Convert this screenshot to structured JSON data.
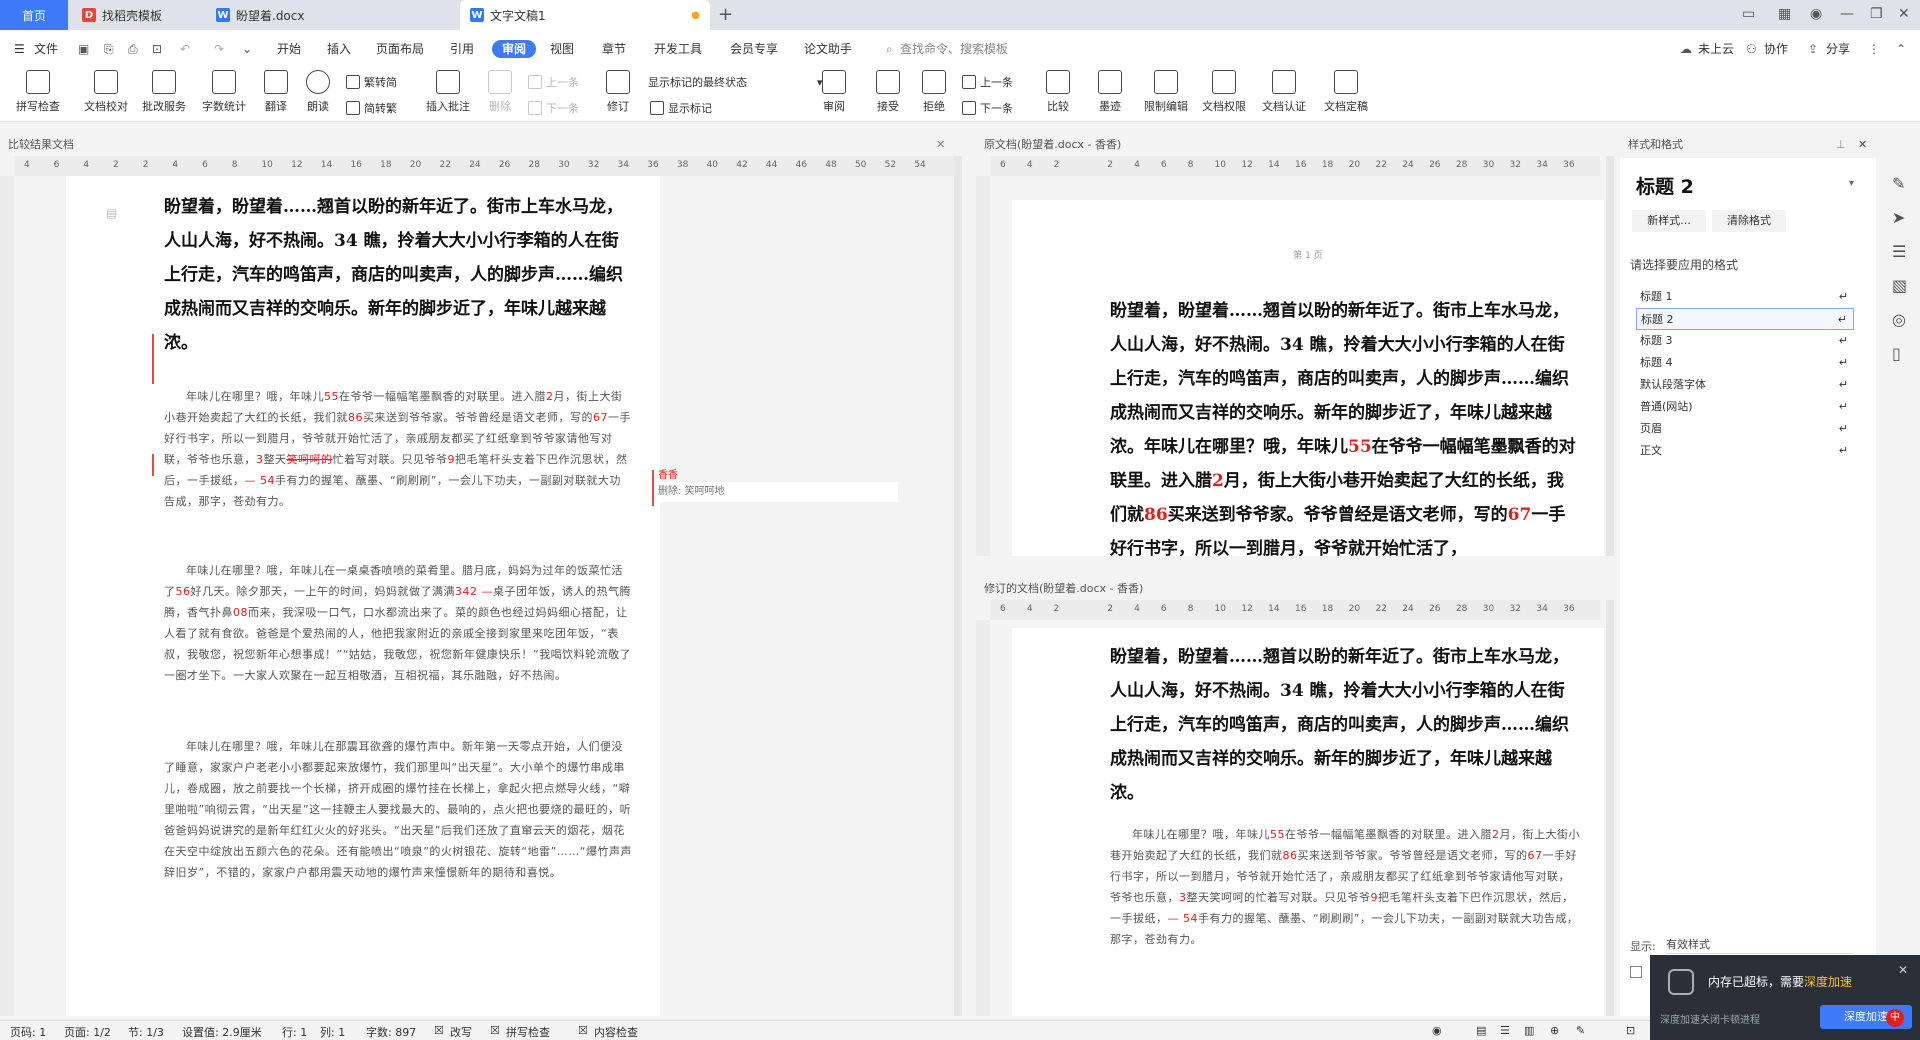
{
  "tabs": {
    "home": "首页",
    "items": [
      {
        "label": "找稻壳模板",
        "icon_color": "#e8453c"
      },
      {
        "label": "盼望着.docx",
        "icon_color": "#2f7bf6"
      },
      {
        "label": "文字文稿1",
        "icon_color": "#2f7bf6"
      }
    ],
    "new_tab": "+"
  },
  "menu": {
    "file": "文件",
    "items": [
      "开始",
      "插入",
      "页面布局",
      "引用",
      "审阅",
      "视图",
      "章节",
      "开发工具",
      "会员专享",
      "论文助手"
    ],
    "active": "审阅",
    "search_placeholder": "查找命令、搜索模板",
    "cloud": "未上云",
    "collab": "协作",
    "share": "分享"
  },
  "ribbon": {
    "buttons": [
      "拼写检查",
      "文档校对",
      "批改服务",
      "字数统计",
      "翻译",
      "朗读"
    ],
    "convert": [
      "繁转简",
      "简转繁"
    ],
    "insert_comment": "插入批注",
    "delete": "删除",
    "prev": "上一条",
    "next": "下一条",
    "revise": "修订",
    "show_final": "显示标记的最终状态",
    "show_markup": "显示标记",
    "review": "审阅",
    "accept": "接受",
    "reject": "拒绝",
    "prev2": "上一条",
    "next2": "下一条",
    "compare": "比较",
    "ink": "墨迹",
    "restrict": "限制编辑",
    "rights": "文档权限",
    "cert": "文档认证",
    "final": "文档定稿"
  },
  "left_pane": {
    "title": "比较结果文档",
    "ruler": [
      "4",
      "6",
      "4",
      "2",
      "2",
      "4",
      "6",
      "8",
      "10",
      "12",
      "14",
      "16",
      "18",
      "20",
      "22",
      "24",
      "26",
      "28",
      "30",
      "32",
      "34",
      "36",
      "38",
      "40",
      "42",
      "44",
      "46",
      "48",
      "50",
      "52",
      "54"
    ],
    "heading": "盼望着，盼望着……翘首以盼的新年近了。街市上车水马龙，人山人海，好不热闹。34 瞧，拎着大大小小行李箱的人在街上行走，汽车的鸣笛声，商店的叫卖声，人的脚步声……编织成热闹而又吉祥的交响乐。新年的脚步近了，年味儿越来越浓。",
    "para1_a": "年味儿在哪里？哦，年味儿",
    "n55": "55",
    "para1_b": "在爷爷一幅幅笔墨飘香的对联里。进入腊",
    "n2": "2",
    "para1_c": "月，街上大街小巷开始卖起了大红的长纸，我们就",
    "n86": "86",
    "para1_d": "买来送到爷爷家。爷爷曾经是语文老师，写的",
    "n67": "67",
    "para1_e": "一手好行书字，所以一到腊月，爷爷就开始忙活了，亲戚朋友都买了红纸拿到爷爷家请他写对联，爷爷也乐意，",
    "n3": "3",
    "para1_f": "整天",
    "del_text": "笑呵呵的",
    "para1_g": "忙着写对联。只见爷爷",
    "n9": "9",
    "para1_h": "把毛笔杆头支着下巴作沉思状，然后，一手拔纸，",
    "n54": "— 54",
    "para1_i": "手有力的握笔、蘸墨、“刷刷刷”，一会儿下功夫，一副副对联就大功告成，那字，苍劲有力。",
    "para2_a": "年味儿在哪里？哦，年味儿在一桌桌香喷喷的菜肴里。腊月底，妈妈为过年的饭菜忙活了",
    "n56": "56",
    "para2_b": "好几天。除夕那天，一上午的时间，妈妈就做了满满",
    "n342": "342 —",
    "para2_c": "桌子团年饭，诱人的热气腾腾，香气扑鼻",
    "n08": "08",
    "para2_d": "而来，我深吸一口气，口水都流出来了。菜的颜色也经过妈妈细心搭配，让人看了就有食欲。爸爸是个爱热闹的人，他把我家附近的亲戚全接到家里来吃团年饭，“表叔，我敬您，祝您新年心想事成！”“姑姑，我敬您，祝您新年健康快乐！”我喝饮料轮流敬了一圈才坐下。一大家人欢聚在一起互相敬酒，互相祝福，其乐融融，好不热闹。",
    "para3": "年味儿在哪里？哦，年味儿在那震耳欲聋的爆竹声中。新年第一天零点开始，人们便没了睡意，家家户户老老小小都要起来放爆竹，我们那里叫“出天星”。大小单个的爆竹串成串儿，卷成圈，放之前要找一个长梯，挤开成圈的爆竹挂在长梯上，拿起火把点燃导火线，“噼里啪啦”响彻云霄，“出天星”这一挂鞭主人要找最大的、最响的，点火把也要烧的最旺的，听爸爸妈妈说讲究的是新年红红火火的好兆头。“出天星”后我们还放了直窜云天的烟花，烟花在天空中绽放出五颜六色的花朵。还有能喷出“喷泉”的火树银花、旋转“地雷”……“爆竹声声辞旧岁”，不错的，家家户户都用震天动地的爆竹声来憧憬新年的期待和喜悦。",
    "comment_author": "香香",
    "comment_label": "删除:",
    "comment_text": "笑呵呵地"
  },
  "top_right_pane": {
    "title": "原文档(盼望着.docx - 香香)",
    "page_label": "第 1 页",
    "heading": "盼望着，盼望着……翘首以盼的新年近了。街市上车水马龙，人山人海，好不热闹。34 瞧，拎着大大小小行李箱的人在街上行走，汽车的鸣笛声，商店的叫卖声，人的脚步声……编织成热闹而又吉祥的交响乐。新年的脚步近了，年味儿越来越浓。",
    "cont_a": "年味儿在哪里？哦，年味儿",
    "n55": "55",
    "cont_b": "在爷爷一幅幅笔墨飘香的对联里。进入腊",
    "n2": "2",
    "cont_c": "月，街上大街小巷开始卖起了大红的长纸，我们就",
    "n86": "86",
    "cont_d": "买来送到爷爷家。爷爷曾经是语文老师，写的",
    "n67": "67",
    "cont_e": "一手好行书字，所以一到腊月，爷爷就开始忙活了，"
  },
  "bottom_right_pane": {
    "title": "修订的文档(盼望着.docx - 香香)",
    "heading": "盼望着，盼望着……翘首以盼的新年近了。街市上车水马龙，人山人海，好不热闹。34 瞧，拎着大大小小行李箱的人在街上行走，汽车的鸣笛声，商店的叫卖声，人的脚步声……编织成热闹而又吉祥的交响乐。新年的脚步近了，年味儿越来越浓。",
    "p_a": "年味儿在哪里？哦，年味儿",
    "n55": "55",
    "p_b": "在爷爷一幅幅笔墨飘香的对联里。进入腊",
    "n2": "2",
    "p_c": "月，街上大街小巷开始卖起了大红的长纸，我们就",
    "n86": "86",
    "p_d": "买来送到爷爷家。爷爷曾经是语文老师，写的",
    "n67": "67",
    "p_e": "一手好行书字，所以一到腊月，爷爷就开始忙活了，亲戚朋友都买了红纸拿到爷爷家请他写对联，爷爷也乐意，",
    "n3": "3",
    "p_f": "整天笑呵呵的忙着写对联。只见爷爷",
    "n9": "9",
    "p_g": "把毛笔杆头支着下巴作沉思状，然后，一手拔纸，",
    "n54": "— 54",
    "p_h": "手有力的握笔、蘸墨、“刷刷刷”，一会儿下功夫，一副副对联就大功告成，那字，苍劲有力。"
  },
  "side_panel": {
    "title": "样式和格式",
    "current_style": "标题 2",
    "new_style": "新样式...",
    "clear_format": "清除格式",
    "choose_label": "请选择要应用的格式",
    "styles": [
      "标题 1",
      "标题 2",
      "标题 3",
      "标题 4",
      "默认段落字体",
      "普通(网站)",
      "页眉",
      "正文"
    ],
    "selected": "标题 2",
    "show_label": "显示:",
    "show_value": "有效样式"
  },
  "status": {
    "page_num": "页码: 1",
    "pages": "页面: 1/2",
    "section": "节: 1/3",
    "setting": "设置值: 2.9厘米",
    "row": "行: 1",
    "col": "列: 1",
    "words": "字数: 897",
    "revise": "改写",
    "spell": "拼写检查",
    "content_check": "内容检查"
  },
  "toast": {
    "text_a": "内存已超标，需要",
    "text_link": "深度加速",
    "sub": "深度加速关闭卡顿进程",
    "btn": "深度加速",
    "ime": "中"
  },
  "colors": {
    "accent": "#3e7bfa",
    "revision_red": "#e02020"
  }
}
